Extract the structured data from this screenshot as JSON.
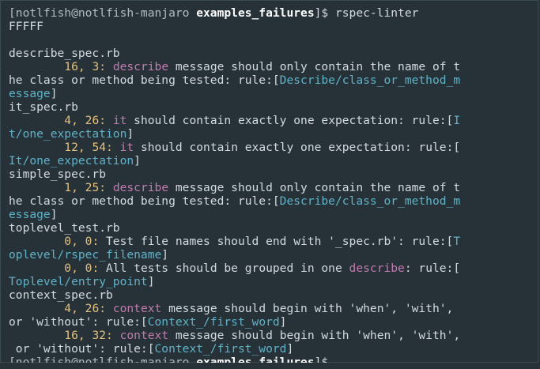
{
  "terminal": {
    "lines": [
      {
        "segments": [
          {
            "text": "[notlfish@notlfish-manjaro ",
            "style": "prompt"
          },
          {
            "text": "examples_failures",
            "style": "bold"
          },
          {
            "text": "]$ rspec-linter",
            "style": "plain"
          }
        ]
      },
      {
        "segments": [
          {
            "text": "FFFFF",
            "style": "plain"
          }
        ]
      },
      {
        "segments": [
          {
            "text": "",
            "style": "plain"
          }
        ]
      },
      {
        "segments": [
          {
            "text": "describe_spec.rb",
            "style": "plain"
          }
        ]
      },
      {
        "segments": [
          {
            "text": "        ",
            "style": "plain"
          },
          {
            "text": "16, 3:",
            "style": "num"
          },
          {
            "text": " ",
            "style": "plain"
          },
          {
            "text": "describe",
            "style": "kw"
          },
          {
            "text": " message should only contain the name of t",
            "style": "plain"
          }
        ]
      },
      {
        "segments": [
          {
            "text": "he class or method being tested: rule:[",
            "style": "plain"
          },
          {
            "text": "Describe/class_or_method_m",
            "style": "rule"
          }
        ]
      },
      {
        "segments": [
          {
            "text": "essage",
            "style": "rule"
          },
          {
            "text": "]",
            "style": "plain"
          }
        ]
      },
      {
        "segments": [
          {
            "text": "it_spec.rb",
            "style": "plain"
          }
        ]
      },
      {
        "segments": [
          {
            "text": "        ",
            "style": "plain"
          },
          {
            "text": "4, 26:",
            "style": "num"
          },
          {
            "text": " ",
            "style": "plain"
          },
          {
            "text": "it",
            "style": "kw"
          },
          {
            "text": " should contain exactly one expectation: rule:[",
            "style": "plain"
          },
          {
            "text": "I",
            "style": "rule"
          }
        ]
      },
      {
        "segments": [
          {
            "text": "t/one_expectation",
            "style": "rule"
          },
          {
            "text": "]",
            "style": "plain"
          }
        ]
      },
      {
        "segments": [
          {
            "text": "        ",
            "style": "plain"
          },
          {
            "text": "12, 54:",
            "style": "num"
          },
          {
            "text": " ",
            "style": "plain"
          },
          {
            "text": "it",
            "style": "kw"
          },
          {
            "text": " should contain exactly one expectation: rule:[",
            "style": "plain"
          }
        ]
      },
      {
        "segments": [
          {
            "text": "It/one_expectation",
            "style": "rule"
          },
          {
            "text": "]",
            "style": "plain"
          }
        ]
      },
      {
        "segments": [
          {
            "text": "simple_spec.rb",
            "style": "plain"
          }
        ]
      },
      {
        "segments": [
          {
            "text": "        ",
            "style": "plain"
          },
          {
            "text": "1, 25:",
            "style": "num"
          },
          {
            "text": " ",
            "style": "plain"
          },
          {
            "text": "describe",
            "style": "kw"
          },
          {
            "text": " message should only contain the name of t",
            "style": "plain"
          }
        ]
      },
      {
        "segments": [
          {
            "text": "he class or method being tested: rule:[",
            "style": "plain"
          },
          {
            "text": "Describe/class_or_method_m",
            "style": "rule"
          }
        ]
      },
      {
        "segments": [
          {
            "text": "essage",
            "style": "rule"
          },
          {
            "text": "]",
            "style": "plain"
          }
        ]
      },
      {
        "segments": [
          {
            "text": "toplevel_test.rb",
            "style": "plain"
          }
        ]
      },
      {
        "segments": [
          {
            "text": "        ",
            "style": "plain"
          },
          {
            "text": "0, 0:",
            "style": "num"
          },
          {
            "text": " Test file names should end with '_spec.rb': rule:[",
            "style": "plain"
          },
          {
            "text": "T",
            "style": "rule"
          }
        ]
      },
      {
        "segments": [
          {
            "text": "oplevel/rspec_filename",
            "style": "rule"
          },
          {
            "text": "]",
            "style": "plain"
          }
        ]
      },
      {
        "segments": [
          {
            "text": "        ",
            "style": "plain"
          },
          {
            "text": "0, 0:",
            "style": "num"
          },
          {
            "text": " All tests should be grouped in one ",
            "style": "plain"
          },
          {
            "text": "describe",
            "style": "kw"
          },
          {
            "text": ": rule:[",
            "style": "plain"
          }
        ]
      },
      {
        "segments": [
          {
            "text": "Toplevel/entry_point",
            "style": "rule"
          },
          {
            "text": "]",
            "style": "plain"
          }
        ]
      },
      {
        "segments": [
          {
            "text": "context_spec.rb",
            "style": "plain"
          }
        ]
      },
      {
        "segments": [
          {
            "text": "        ",
            "style": "plain"
          },
          {
            "text": "4, 26:",
            "style": "num"
          },
          {
            "text": " ",
            "style": "plain"
          },
          {
            "text": "context",
            "style": "kw"
          },
          {
            "text": " message should begin with 'when', 'with',",
            "style": "plain"
          }
        ]
      },
      {
        "segments": [
          {
            "text": "or 'without': rule:[",
            "style": "plain"
          },
          {
            "text": "Context_/first_word",
            "style": "rule"
          },
          {
            "text": "]",
            "style": "plain"
          }
        ]
      },
      {
        "segments": [
          {
            "text": "        ",
            "style": "plain"
          },
          {
            "text": "16, 32:",
            "style": "num"
          },
          {
            "text": " ",
            "style": "plain"
          },
          {
            "text": "context",
            "style": "kw"
          },
          {
            "text": " message should begin with 'when', 'with',",
            "style": "plain"
          }
        ]
      },
      {
        "segments": [
          {
            "text": " or 'without': rule:[",
            "style": "plain"
          },
          {
            "text": "Context_/first_word",
            "style": "rule"
          },
          {
            "text": "]",
            "style": "plain"
          }
        ]
      },
      {
        "segments": [
          {
            "text": "[notlfish@notlfish-manjaro ",
            "style": "prompt"
          },
          {
            "text": "examples_failures",
            "style": "bold"
          },
          {
            "text": "]$",
            "style": "plain"
          }
        ],
        "partial": true
      }
    ]
  },
  "colors": {
    "background": "#263238",
    "text": "#d3dae3",
    "number": "#e5c07b",
    "keyword": "#c27bb0",
    "rule": "#5fb3c8"
  }
}
